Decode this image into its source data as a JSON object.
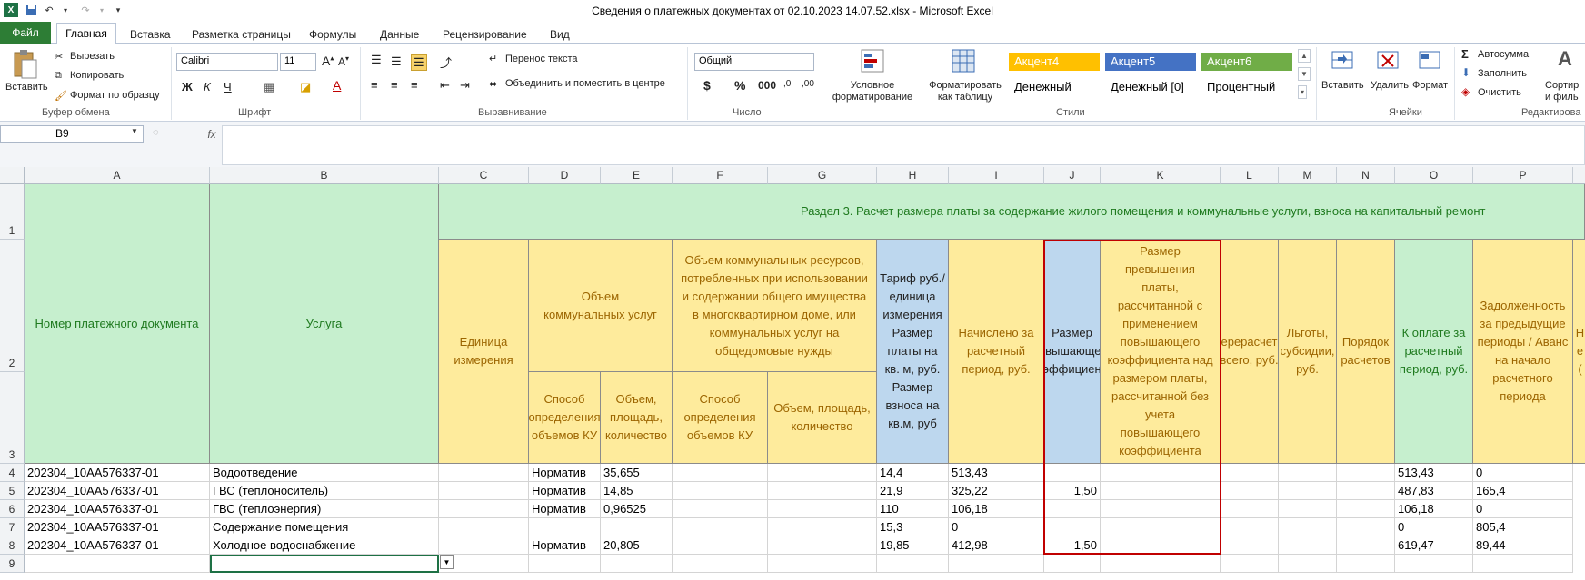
{
  "window": {
    "title": "Сведения о платежных документах от 02.10.2023 14.07.52.xlsx  -  Microsoft Excel"
  },
  "ribbon_tabs": [
    "Файл",
    "Главная",
    "Вставка",
    "Разметка страницы",
    "Формулы",
    "Данные",
    "Рецензирование",
    "Вид"
  ],
  "ribbon": {
    "clipboard": {
      "paste": "Вставить",
      "cut": "Вырезать",
      "copy": "Копировать",
      "format_painter": "Формат по образцу",
      "group": "Буфер обмена"
    },
    "font": {
      "name": "Calibri",
      "size": "11",
      "group": "Шрифт"
    },
    "alignment": {
      "wrap": "Перенос текста",
      "merge": "Объединить и поместить в центре",
      "group": "Выравнивание"
    },
    "number": {
      "format": "Общий",
      "group": "Число"
    },
    "styles": {
      "conditional": "Условное форматирование",
      "as_table": "Форматировать как таблицу",
      "group": "Стили",
      "cells": [
        {
          "label": "Акцент4",
          "bg": "#ffc000",
          "fg": "#ffffff"
        },
        {
          "label": "Акцент5",
          "bg": "#4472c4",
          "fg": "#ffffff"
        },
        {
          "label": "Акцент6",
          "bg": "#70ad47",
          "fg": "#ffffff"
        },
        {
          "label": "Денежный",
          "bg": "#ffffff",
          "fg": "#000000"
        },
        {
          "label": "Денежный [0]",
          "bg": "#ffffff",
          "fg": "#000000"
        },
        {
          "label": "Процентный",
          "bg": "#ffffff",
          "fg": "#000000"
        }
      ]
    },
    "cells": {
      "insert": "Вставить",
      "delete": "Удалить",
      "format": "Формат",
      "group": "Ячейки"
    },
    "editing": {
      "autosum": "Автосумма",
      "fill": "Заполнить",
      "clear": "Очистить",
      "sort": "Сортир и филь",
      "group": "Редактирова"
    }
  },
  "formula_bar": {
    "name_box": "B9",
    "fx": "fx",
    "value": ""
  },
  "columns": [
    "A",
    "B",
    "C",
    "D",
    "E",
    "F",
    "G",
    "H",
    "I",
    "J",
    "K",
    "L",
    "M",
    "N",
    "O",
    "P"
  ],
  "rows": [
    "1",
    "2",
    "3",
    "4",
    "5",
    "6",
    "7",
    "8",
    "9"
  ],
  "headers": {
    "section": "Раздел 3. Расчет размера платы за содержание жилого помещения и коммунальные услуги, взноса на капитальный ремонт",
    "A": "Номер платежного документа",
    "B": "Услуга",
    "C": "Единица измерения",
    "DE": "Объем коммунальных услуг",
    "D": "Способ определения объемов КУ",
    "E": "Объем, площадь, количество",
    "FG": "Объем коммунальных ресурсов, потребленных при использовании и содержании общего имущества в многоквартирном доме, или коммунальных услуг на общедомовые нужды",
    "F": "Способ определения объемов КУ",
    "G": "Объем, площадь, количество",
    "H": "Тариф руб./единица измерения Размер платы на кв. м, руб. Размер взноса на кв.м, руб",
    "I": "Начислено за расчетный период, руб.",
    "J": "Размер повышающего коэффициента",
    "K": "Размер превышения платы, рассчитанной с применением повышающего коэффициента над размером платы, рассчитанной без учета повышающего коэффициента",
    "L": "Перерасчеты всего, руб.",
    "M": "Льготы, субсидии, руб.",
    "N": "Порядок расчетов",
    "O": "К оплате за расчетный период, руб.",
    "P": "Задолженность за предыдущие периоды / Аванс на начало расчетного периода",
    "Q": "Не ("
  },
  "data_rows": [
    {
      "A": "202304_10AA576337-01",
      "B": "Водоотведение",
      "D": "Норматив",
      "E": "35,655",
      "H": "14,4",
      "I": "513,43",
      "J": "",
      "O": "513,43",
      "P": "0"
    },
    {
      "A": "202304_10AA576337-01",
      "B": "ГВС (теплоноситель)",
      "D": "Норматив",
      "E": "14,85",
      "H": "21,9",
      "I": "325,22",
      "J": "1,50",
      "O": "487,83",
      "P": "165,4"
    },
    {
      "A": "202304_10AA576337-01",
      "B": "ГВС (теплоэнергия)",
      "D": "Норматив",
      "E": "0,96525",
      "H": "110",
      "I": "106,18",
      "J": "",
      "O": "106,18",
      "P": "0"
    },
    {
      "A": "202304_10AA576337-01",
      "B": "Содержание помещения",
      "D": "",
      "E": "",
      "H": "15,3",
      "I": "0",
      "J": "",
      "O": "0",
      "P": "805,4"
    },
    {
      "A": "202304_10AA576337-01",
      "B": "Холодное водоснабжение",
      "D": "Норматив",
      "E": "20,805",
      "H": "19,85",
      "I": "412,98",
      "J": "1,50",
      "O": "619,47",
      "P": "89,44"
    }
  ]
}
